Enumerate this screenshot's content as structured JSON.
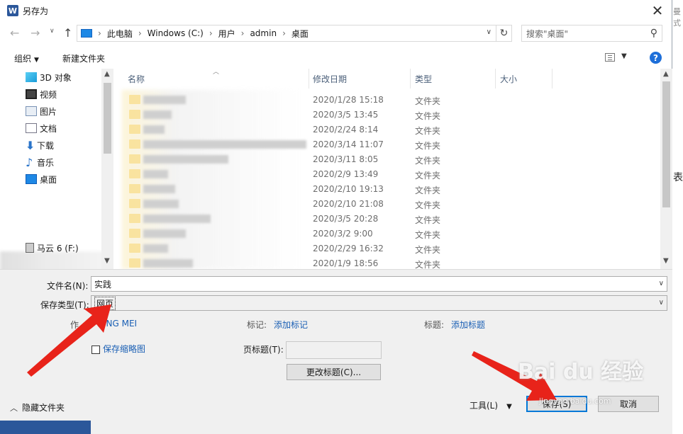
{
  "window": {
    "title": "另存为",
    "close_glyph": "✕"
  },
  "edge_text": {
    "top": "曼式",
    "middle": "表"
  },
  "nav": {
    "breadcrumbs": [
      "此电脑",
      "Windows (C:)",
      "用户",
      "admin",
      "桌面"
    ],
    "search_placeholder": "搜索\"桌面\""
  },
  "toolbar": {
    "organize": "组织",
    "new_folder": "新建文件夹"
  },
  "sidebar": {
    "items": [
      {
        "label": "3D 对象",
        "icon": "3d-objects-icon"
      },
      {
        "label": "视频",
        "icon": "video-icon"
      },
      {
        "label": "图片",
        "icon": "pictures-icon"
      },
      {
        "label": "文档",
        "icon": "documents-icon"
      },
      {
        "label": "下载",
        "icon": "download-icon"
      },
      {
        "label": "音乐",
        "icon": "music-icon"
      },
      {
        "label": "桌面",
        "icon": "desktop-icon"
      },
      {
        "label": "马云 6 (F:)",
        "icon": "drive-icon"
      }
    ]
  },
  "filelist": {
    "columns": [
      "名称",
      "修改日期",
      "类型",
      "大小"
    ],
    "rows": [
      {
        "date": "2020/1/28 15:18",
        "type": "文件夹"
      },
      {
        "date": "2020/3/5 13:45",
        "type": "文件夹"
      },
      {
        "date": "2020/2/24 8:14",
        "type": "文件夹"
      },
      {
        "date": "2020/3/14 11:07",
        "type": "文件夹"
      },
      {
        "date": "2020/3/11 8:05",
        "type": "文件夹"
      },
      {
        "date": "2020/2/9 13:49",
        "type": "文件夹"
      },
      {
        "date": "2020/2/10 19:13",
        "type": "文件夹"
      },
      {
        "date": "2020/2/10 21:08",
        "type": "文件夹"
      },
      {
        "date": "2020/3/5 20:28",
        "type": "文件夹"
      },
      {
        "date": "2020/3/2 9:00",
        "type": "文件夹"
      },
      {
        "date": "2020/2/29 16:32",
        "type": "文件夹"
      },
      {
        "date": "2020/1/9 18:56",
        "type": "文件夹"
      }
    ]
  },
  "form": {
    "filename_label": "文件名(N):",
    "filename_value": "实践",
    "filetype_label": "保存类型(T):",
    "filetype_value": "网页",
    "author_label": "作",
    "author_value": "NING MEI",
    "tags_label": "标记:",
    "tags_link": "添加标记",
    "title_label": "标题:",
    "title_link": "添加标题",
    "thumbnail_label": "保存缩略图",
    "page_title_label": "页标题(T):",
    "change_title_button": "更改标题(C)...",
    "hide_folders": "隐藏文件夹",
    "tools": "工具(L)",
    "save": "保存(S)",
    "cancel": "取消"
  },
  "watermark": {
    "main": "Bai du 经验",
    "sub": "jingyan.baidu.com"
  },
  "colors": {
    "accent": "#0078d7",
    "word_blue": "#2b579a",
    "arrow_red": "#e8231a",
    "link": "#1a5fb4"
  }
}
